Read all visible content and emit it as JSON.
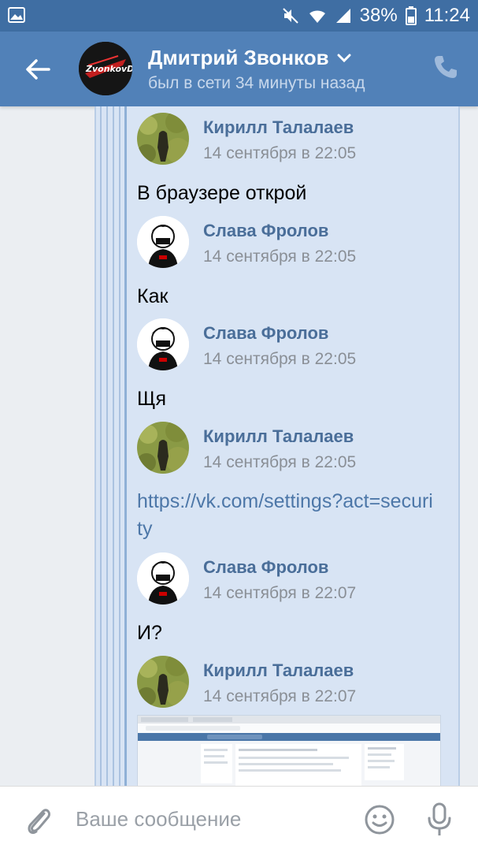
{
  "status_bar": {
    "battery": "38%",
    "time": "11:24"
  },
  "header": {
    "name": "Дмитрий Звонков",
    "status": "был в сети 34 минуты назад",
    "avatar_text": "ZvonkovD"
  },
  "messages": [
    {
      "author": "Кирилл Талалаев",
      "time": "14 сентября в 22:05",
      "text": "В браузере открой"
    },
    {
      "author": "Слава Фролов",
      "time": "14 сентября в 22:05",
      "text": "Как"
    },
    {
      "author": "Слава Фролов",
      "time": "14 сентября в 22:05",
      "text": "Щя"
    },
    {
      "author": "Кирилл Талалаев",
      "time": "14 сентября в 22:05",
      "link": "https://vk.com/settings?act=security"
    },
    {
      "author": "Слава Фролов",
      "time": "14 сентября в 22:07",
      "text": "И?"
    },
    {
      "author": "Кирилл Талалаев",
      "time": "14 сентября в 22:07"
    }
  ],
  "composer": {
    "placeholder": "Ваше сообщение"
  },
  "colors": {
    "header": "#5181b8",
    "statusbar": "#3f6ea3",
    "thread_bg": "#d8e4f4",
    "author": "#4a6e99",
    "link": "#4d77a8"
  },
  "icons": [
    "gallery-icon",
    "mute-icon",
    "wifi-icon",
    "signal-icon",
    "back-arrow-icon",
    "chevron-down-icon",
    "phone-icon",
    "attach-icon",
    "emoji-icon",
    "microphone-icon"
  ]
}
